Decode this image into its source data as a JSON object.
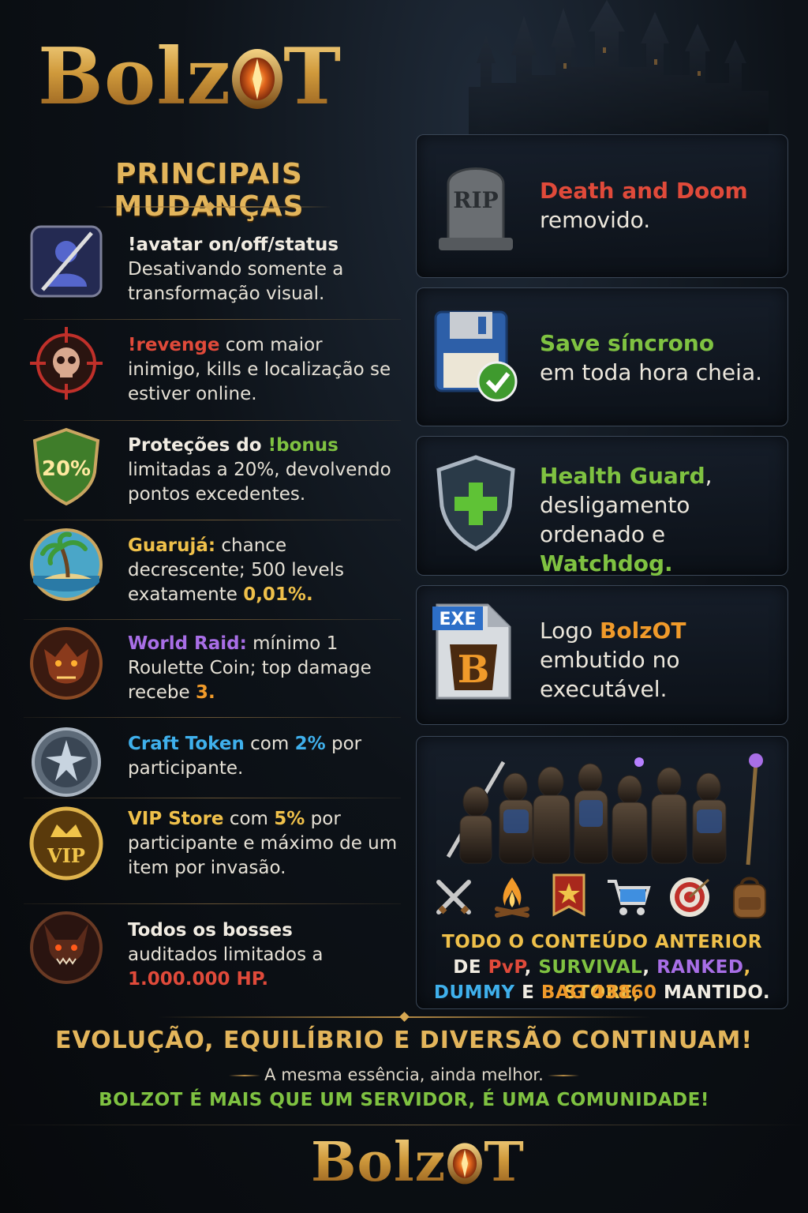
{
  "brand": {
    "logo_text": "BolzOT",
    "logo_prefix": "Bolz",
    "logo_suffix": "T",
    "colors": {
      "gold": "#e3b55b",
      "red": "#e04a3a",
      "green": "#7fc241",
      "purple": "#a86ee6",
      "blue": "#3fb0ec",
      "orange": "#f09a2a"
    }
  },
  "headline": "PRINCIPAIS MUDANÇAS",
  "changes": [
    {
      "icon": "avatar-off-icon",
      "parts": [
        {
          "t": "!avatar on/off/status",
          "c": "white",
          "b": true,
          "br": true
        },
        {
          "t": "Desativando somente a transformação visual."
        }
      ]
    },
    {
      "icon": "crosshair-skull-icon",
      "parts": [
        {
          "t": "!revenge",
          "c": "red",
          "b": true
        },
        {
          "t": " com maior inimigo, kills e localização se estiver online."
        }
      ]
    },
    {
      "icon": "shield-20-icon",
      "badge": "20%",
      "parts": [
        {
          "t": "Proteções do ",
          "b": true,
          "c": "white"
        },
        {
          "t": "!bonus",
          "c": "green",
          "b": true,
          "br": true
        },
        {
          "t": "limitadas a 20%, devolvendo pontos excedentes."
        }
      ]
    },
    {
      "icon": "palm-island-icon",
      "parts": [
        {
          "t": "Guarujá:",
          "c": "gold",
          "b": true
        },
        {
          "t": " chance decrescente; 500 levels exatamente "
        },
        {
          "t": "0,01%.",
          "c": "gold",
          "b": true
        }
      ]
    },
    {
      "icon": "dragon-head-icon",
      "parts": [
        {
          "t": "World Raid:",
          "c": "purple",
          "b": true
        },
        {
          "t": " mínimo 1 Roulette Coin; top damage recebe "
        },
        {
          "t": "3.",
          "c": "orange",
          "b": true
        }
      ]
    },
    {
      "icon": "craft-token-icon",
      "parts": [
        {
          "t": "Craft Token",
          "c": "blue",
          "b": true
        },
        {
          "t": " com "
        },
        {
          "t": "2%",
          "c": "blue",
          "b": true
        },
        {
          "t": " por participante."
        }
      ]
    },
    {
      "icon": "vip-crown-icon",
      "badge": "VIP",
      "parts": [
        {
          "t": "VIP Store",
          "c": "gold",
          "b": true
        },
        {
          "t": " com "
        },
        {
          "t": "5%",
          "c": "gold",
          "b": true
        },
        {
          "t": " por participante e máximo de um item por invasão."
        }
      ]
    },
    {
      "icon": "demon-boss-icon",
      "parts": [
        {
          "t": "Todos os bosses",
          "c": "white",
          "b": true,
          "br": true
        },
        {
          "t": "auditados limitados a "
        },
        {
          "t": "1.000.000 HP.",
          "c": "red",
          "b": true
        }
      ]
    }
  ],
  "cards": [
    {
      "icon": "tombstone-icon",
      "badge": "RIP",
      "parts": [
        {
          "t": "Death and Doom",
          "c": "red",
          "b": true,
          "br": true
        },
        {
          "t": "removido."
        }
      ]
    },
    {
      "icon": "floppy-check-icon",
      "parts": [
        {
          "t": "Save síncrono",
          "c": "green",
          "b": true,
          "br": true
        },
        {
          "t": "em toda hora cheia."
        }
      ]
    },
    {
      "icon": "shield-plus-icon",
      "parts": [
        {
          "t": "Health Guard",
          "c": "green",
          "b": true
        },
        {
          "t": ", desligamento ordenado e "
        },
        {
          "t": "Watchdog.",
          "c": "green",
          "b": true
        }
      ]
    },
    {
      "icon": "exe-file-icon",
      "badge": "EXE",
      "badge2": "B",
      "parts": [
        {
          "t": "Logo "
        },
        {
          "t": "BolzOT",
          "c": "orange",
          "b": true
        },
        {
          "t": " embutido no executável."
        }
      ]
    }
  ],
  "legacy_banner": {
    "icons": [
      "crossed-swords-icon",
      "campfire-icon",
      "banner-star-icon",
      "shopping-cart-icon",
      "target-icon",
      "backpack-icon"
    ],
    "line1": [
      {
        "t": "TODO O CONTEÚDO ANTERIOR",
        "c": "gold"
      }
    ],
    "line2": [
      {
        "t": "DE ",
        "c": "white"
      },
      {
        "t": "PvP",
        "c": "red"
      },
      {
        "t": ", ",
        "c": "white"
      },
      {
        "t": "SURVIVAL",
        "c": "green"
      },
      {
        "t": ", ",
        "c": "white"
      },
      {
        "t": "RANKED",
        "c": "purple"
      },
      {
        "t": ", STORE,",
        "c": "gold"
      }
    ],
    "line3": [
      {
        "t": "DUMMY",
        "c": "blue"
      },
      {
        "t": " E ",
        "c": "white"
      },
      {
        "t": "BAG 43860",
        "c": "orange"
      },
      {
        "t": " MANTIDO.",
        "c": "white"
      }
    ]
  },
  "footer": {
    "line1": "EVOLUÇÃO, EQUILÍBRIO E DIVERSÃO CONTINUAM!",
    "line2": "A mesma essência, ainda melhor.",
    "line3": "BOLZOT É MAIS QUE UM SERVIDOR, É UMA COMUNIDADE!"
  }
}
